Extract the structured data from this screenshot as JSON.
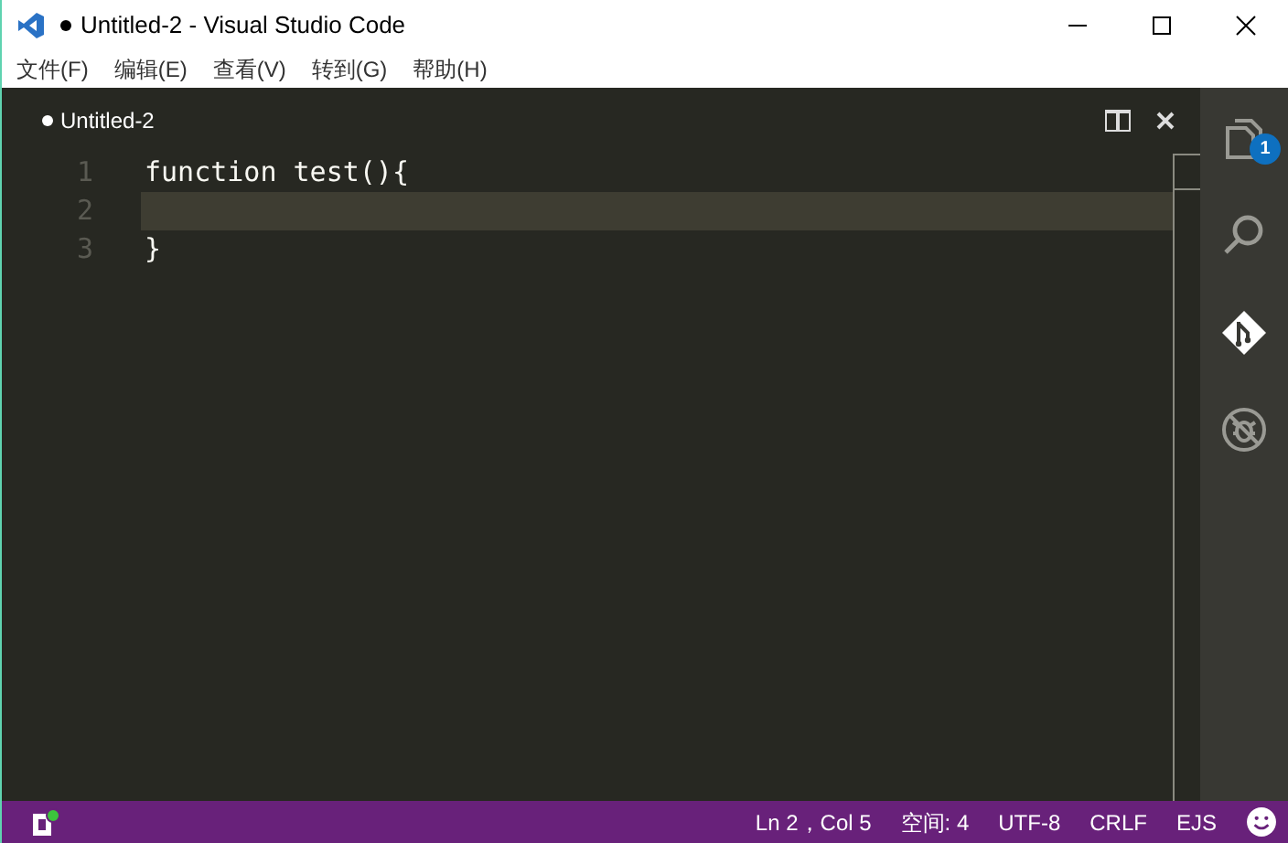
{
  "window": {
    "title": "Untitled-2 - Visual Studio Code",
    "dirty": true
  },
  "menu": [
    "文件(F)",
    "编辑(E)",
    "查看(V)",
    "转到(G)",
    "帮助(H)"
  ],
  "tab": {
    "label": "Untitled-2",
    "dirty": true
  },
  "editor": {
    "lines": [
      {
        "number": "1",
        "code": "function test(){",
        "current": false
      },
      {
        "number": "2",
        "current": true
      },
      {
        "number": "3",
        "code": "}",
        "current": false
      }
    ]
  },
  "activity_bar": [
    {
      "kind": "files",
      "selected": false,
      "badge": "1"
    },
    {
      "kind": "search",
      "selected": false
    },
    {
      "kind": "git",
      "selected": true
    },
    {
      "kind": "debug",
      "selected": false
    }
  ],
  "status_bar": {
    "items": [
      "Ln 2，Col 5",
      "空间: 4",
      "UTF-8",
      "CRLF",
      "EJS"
    ]
  }
}
